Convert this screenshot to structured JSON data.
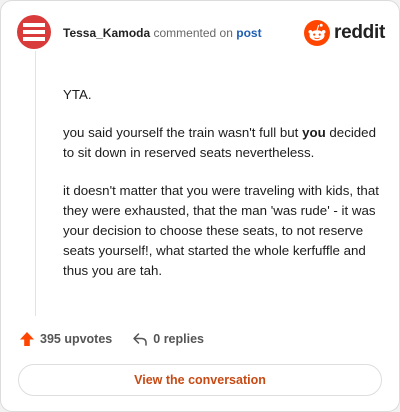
{
  "header": {
    "username": "Tessa_Kamoda",
    "action_text": "commented on",
    "link_text": "post",
    "brand": "reddit"
  },
  "icons": {
    "avatar": "red-avatar-with-white-stripes",
    "logo": "reddit-snoo-icon",
    "upvote": "upvote-arrow-icon",
    "reply": "reply-arrow-icon"
  },
  "colors": {
    "accent": "#ff4500",
    "link": "#1f5fb3",
    "button_text": "#c74a14"
  },
  "comment": {
    "paragraphs": [
      {
        "text": "YTA."
      },
      {
        "before": "you said yourself the train wasn't full but ",
        "bold": "you",
        "after": " decided to sit down in reserved seats nevertheless."
      },
      {
        "text": "it doesn't matter that you were traveling with kids, that they were exhausted, that the man 'was rude' - it was your decision to choose these seats, to not reserve seats yourself!, what started the whole kerfuffle and thus you are tah."
      }
    ]
  },
  "stats": {
    "upvotes": "395 upvotes",
    "replies": "0 replies"
  },
  "cta": {
    "label": "View the conversation"
  }
}
